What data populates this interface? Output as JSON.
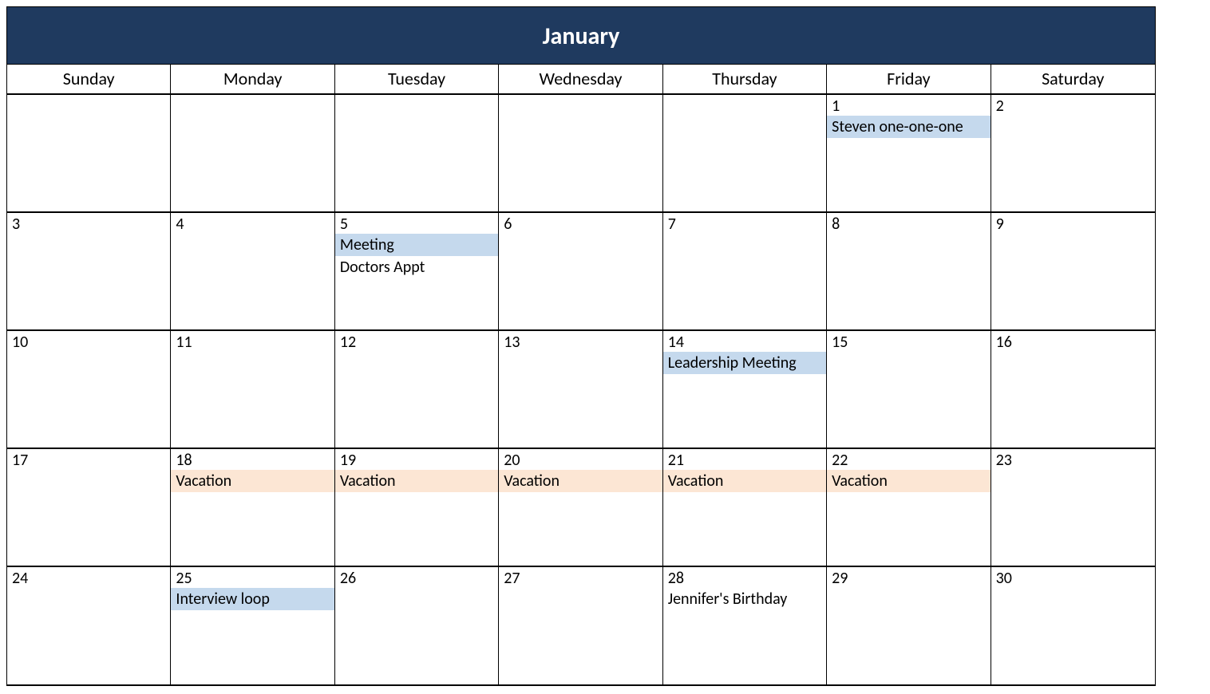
{
  "month_title": "January",
  "day_names": [
    "Sunday",
    "Monday",
    "Tuesday",
    "Wednesday",
    "Thursday",
    "Friday",
    "Saturday"
  ],
  "colors": {
    "header_bg": "#1f3a5f",
    "event_blue": "#c5d9ed",
    "event_peach": "#fce6d4"
  },
  "weeks": [
    [
      {
        "day": "",
        "events": []
      },
      {
        "day": "",
        "events": []
      },
      {
        "day": "",
        "events": []
      },
      {
        "day": "",
        "events": []
      },
      {
        "day": "",
        "events": []
      },
      {
        "day": "1",
        "events": [
          {
            "label": "Steven one-one-one",
            "color": "blue"
          }
        ]
      },
      {
        "day": "2",
        "events": []
      }
    ],
    [
      {
        "day": "3",
        "events": []
      },
      {
        "day": "4",
        "events": []
      },
      {
        "day": "5",
        "events": [
          {
            "label": "Meeting",
            "color": "blue"
          },
          {
            "label": "Doctors Appt",
            "color": "plain"
          }
        ]
      },
      {
        "day": "6",
        "events": []
      },
      {
        "day": "7",
        "events": []
      },
      {
        "day": "8",
        "events": []
      },
      {
        "day": "9",
        "events": []
      }
    ],
    [
      {
        "day": "10",
        "events": []
      },
      {
        "day": "11",
        "events": []
      },
      {
        "day": "12",
        "events": []
      },
      {
        "day": "13",
        "events": []
      },
      {
        "day": "14",
        "events": [
          {
            "label": "Leadership Meeting",
            "color": "blue"
          }
        ]
      },
      {
        "day": "15",
        "events": []
      },
      {
        "day": "16",
        "events": []
      }
    ],
    [
      {
        "day": "17",
        "events": []
      },
      {
        "day": "18",
        "events": [
          {
            "label": "Vacation",
            "color": "peach"
          }
        ]
      },
      {
        "day": "19",
        "events": [
          {
            "label": "Vacation",
            "color": "peach"
          }
        ]
      },
      {
        "day": "20",
        "events": [
          {
            "label": "Vacation",
            "color": "peach"
          }
        ]
      },
      {
        "day": "21",
        "events": [
          {
            "label": "Vacation",
            "color": "peach"
          }
        ]
      },
      {
        "day": "22",
        "events": [
          {
            "label": "Vacation",
            "color": "peach"
          }
        ]
      },
      {
        "day": "23",
        "events": []
      }
    ],
    [
      {
        "day": "24",
        "events": []
      },
      {
        "day": "25",
        "events": [
          {
            "label": "Interview loop",
            "color": "blue"
          }
        ]
      },
      {
        "day": "26",
        "events": []
      },
      {
        "day": "27",
        "events": []
      },
      {
        "day": "28",
        "events": [
          {
            "label": "Jennifer's Birthday",
            "color": "plain"
          }
        ]
      },
      {
        "day": "29",
        "events": []
      },
      {
        "day": "30",
        "events": []
      }
    ]
  ]
}
